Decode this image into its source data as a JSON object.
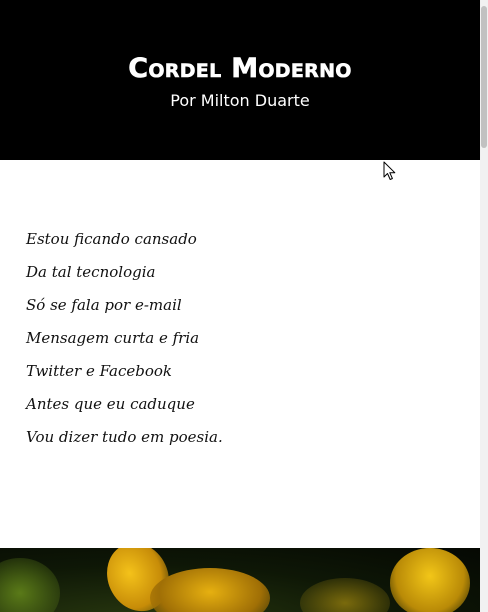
{
  "header": {
    "site_title": "Cordel Moderno",
    "byline_prefix": "Por",
    "author": "Milton Duarte"
  },
  "poem": {
    "lines": [
      "Estou ficando cansado",
      "Da tal tecnologia",
      "Só se fala por e-mail",
      "Mensagem curta e fria",
      "Twitter e Facebook",
      "Antes que eu caduque",
      "Vou dizer tudo em poesia."
    ]
  },
  "colors": {
    "header_background": "#000000",
    "header_text": "#ffffff",
    "body_background": "#ffffff",
    "poem_text": "#111111",
    "flower_yellow": "#f2c618",
    "leaf_green": "#0e1706"
  },
  "icons": {
    "pointer": "mouse-pointer-icon"
  }
}
